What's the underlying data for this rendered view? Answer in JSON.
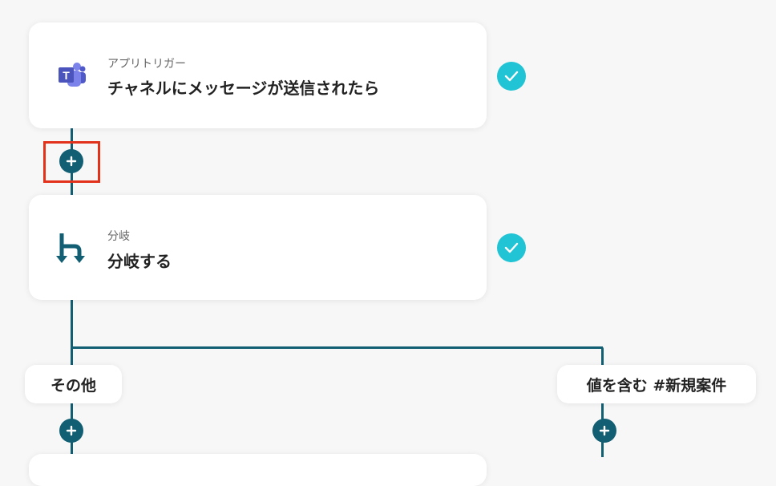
{
  "trigger_card": {
    "subtitle": "アプリトリガー",
    "title": "チャネルにメッセージが送信されたら",
    "app_icon": "teams-icon",
    "status_icon": "check-icon"
  },
  "branch_card": {
    "subtitle": "分岐",
    "title": "分岐する",
    "app_icon": "branch-icon",
    "status_icon": "check-icon"
  },
  "branches": {
    "left_label": "その他",
    "right_label": "値を含む #新規案件"
  },
  "add_step_icon": "plus-icon",
  "colors": {
    "connector": "#125f73",
    "check": "#20c4d4",
    "highlight": "#e3321b"
  }
}
